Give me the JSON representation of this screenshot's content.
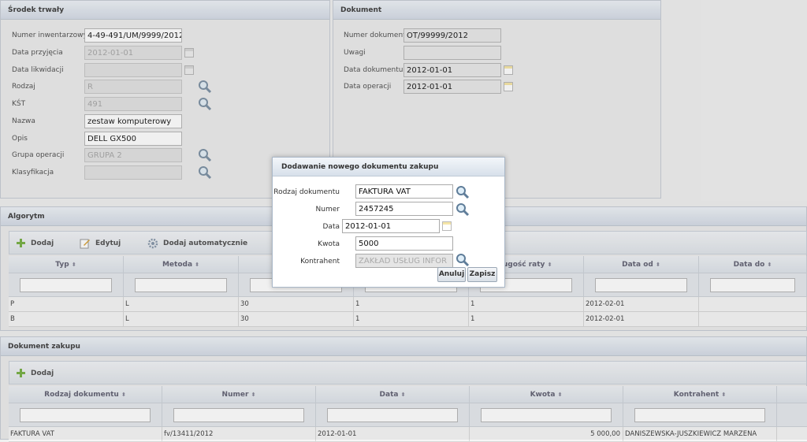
{
  "srodek": {
    "title": "Środek trwały",
    "fields": [
      {
        "label": "Numer inwentarzowy",
        "value": "4-49-491/UM/9999/2012",
        "disabled": false
      },
      {
        "label": "Data przyjęcia",
        "value": "2012-01-01",
        "disabled": true
      },
      {
        "label": "Data likwidacji",
        "value": "",
        "disabled": true
      },
      {
        "label": "Rodzaj",
        "value": "R",
        "disabled": true
      },
      {
        "label": "KŚT",
        "value": "491",
        "disabled": true
      },
      {
        "label": "Nazwa",
        "value": "zestaw komputerowy",
        "disabled": false
      },
      {
        "label": "Opis",
        "value": "DELL GX500",
        "disabled": false
      },
      {
        "label": "Grupa operacji",
        "value": "GRUPA 2",
        "disabled": true
      },
      {
        "label": "Klasyfikacja",
        "value": "",
        "disabled": true
      }
    ]
  },
  "dokument": {
    "title": "Dokument",
    "fields": [
      {
        "label": "Numer dokumentu",
        "value": "OT/99999/2012"
      },
      {
        "label": "Uwagi",
        "value": ""
      },
      {
        "label": "Data dokumentu",
        "value": "2012-01-01"
      },
      {
        "label": "Data operacji",
        "value": "2012-01-01"
      }
    ]
  },
  "algorytm": {
    "title": "Algorytm",
    "toolbar": {
      "add": "Dodaj",
      "edit": "Edytuj",
      "auto_add": "Dodaj automatycznie"
    },
    "columns": [
      "Typ",
      "Metoda",
      "",
      "",
      "ługość raty",
      "Data od",
      "Data do"
    ],
    "rows": [
      [
        "P",
        "L",
        "30",
        "1",
        "1",
        "2012-02-01",
        ""
      ],
      [
        "B",
        "L",
        "30",
        "1",
        "1",
        "2012-02-01",
        ""
      ]
    ]
  },
  "dokument_zakupu": {
    "title": "Dokument zakupu",
    "toolbar": {
      "add": "Dodaj"
    },
    "columns": [
      "Rodzaj dokumentu",
      "Numer",
      "Data",
      "Kwota",
      "Kontrahent"
    ],
    "rows": [
      [
        "FAKTURA VAT",
        "fv/13411/2012",
        "2012-01-01",
        "5 000,00",
        "DANISZEWSKA-JUSZKIEWICZ MARZENA"
      ]
    ]
  },
  "sort_glyph": "⬍",
  "dialog": {
    "title": "Dodawanie nowego dokumentu zakupu",
    "rodzaj_label": "Rodzaj dokumentu",
    "rodzaj_value": "FAKTURA VAT",
    "numer_label": "Numer",
    "numer_value": "2457245",
    "data_label": "Data",
    "data_value": "2012-01-01",
    "kwota_label": "Kwota",
    "kwota_value": "5000",
    "kontrahent_label": "Kontrahent",
    "kontrahent_value": "ZAKŁAD USŁUG INFOR",
    "cancel_label": "Anuluj",
    "save_label": "Zapisz"
  }
}
